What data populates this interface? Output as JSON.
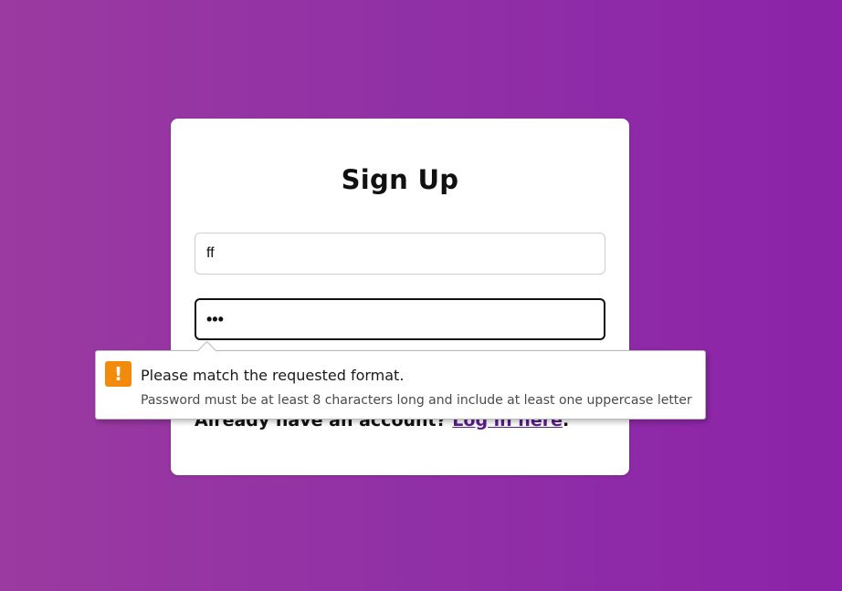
{
  "page": {
    "background_gradient": [
      "#9b3aa0",
      "#8c23a8"
    ]
  },
  "form": {
    "title": "Sign Up",
    "username_value": "ff",
    "password_value": "•••",
    "login_prompt": "Already have an account?",
    "login_link": "Log in here",
    "login_suffix": ".",
    "link_color": "#5a1e8c"
  },
  "validation_tooltip": {
    "icon": "warning-icon",
    "icon_glyph": "!",
    "icon_color": "#f28a0c",
    "message": "Please match the requested format.",
    "detail": "Password must be at least 8 characters long and include at least one uppercase letter"
  }
}
